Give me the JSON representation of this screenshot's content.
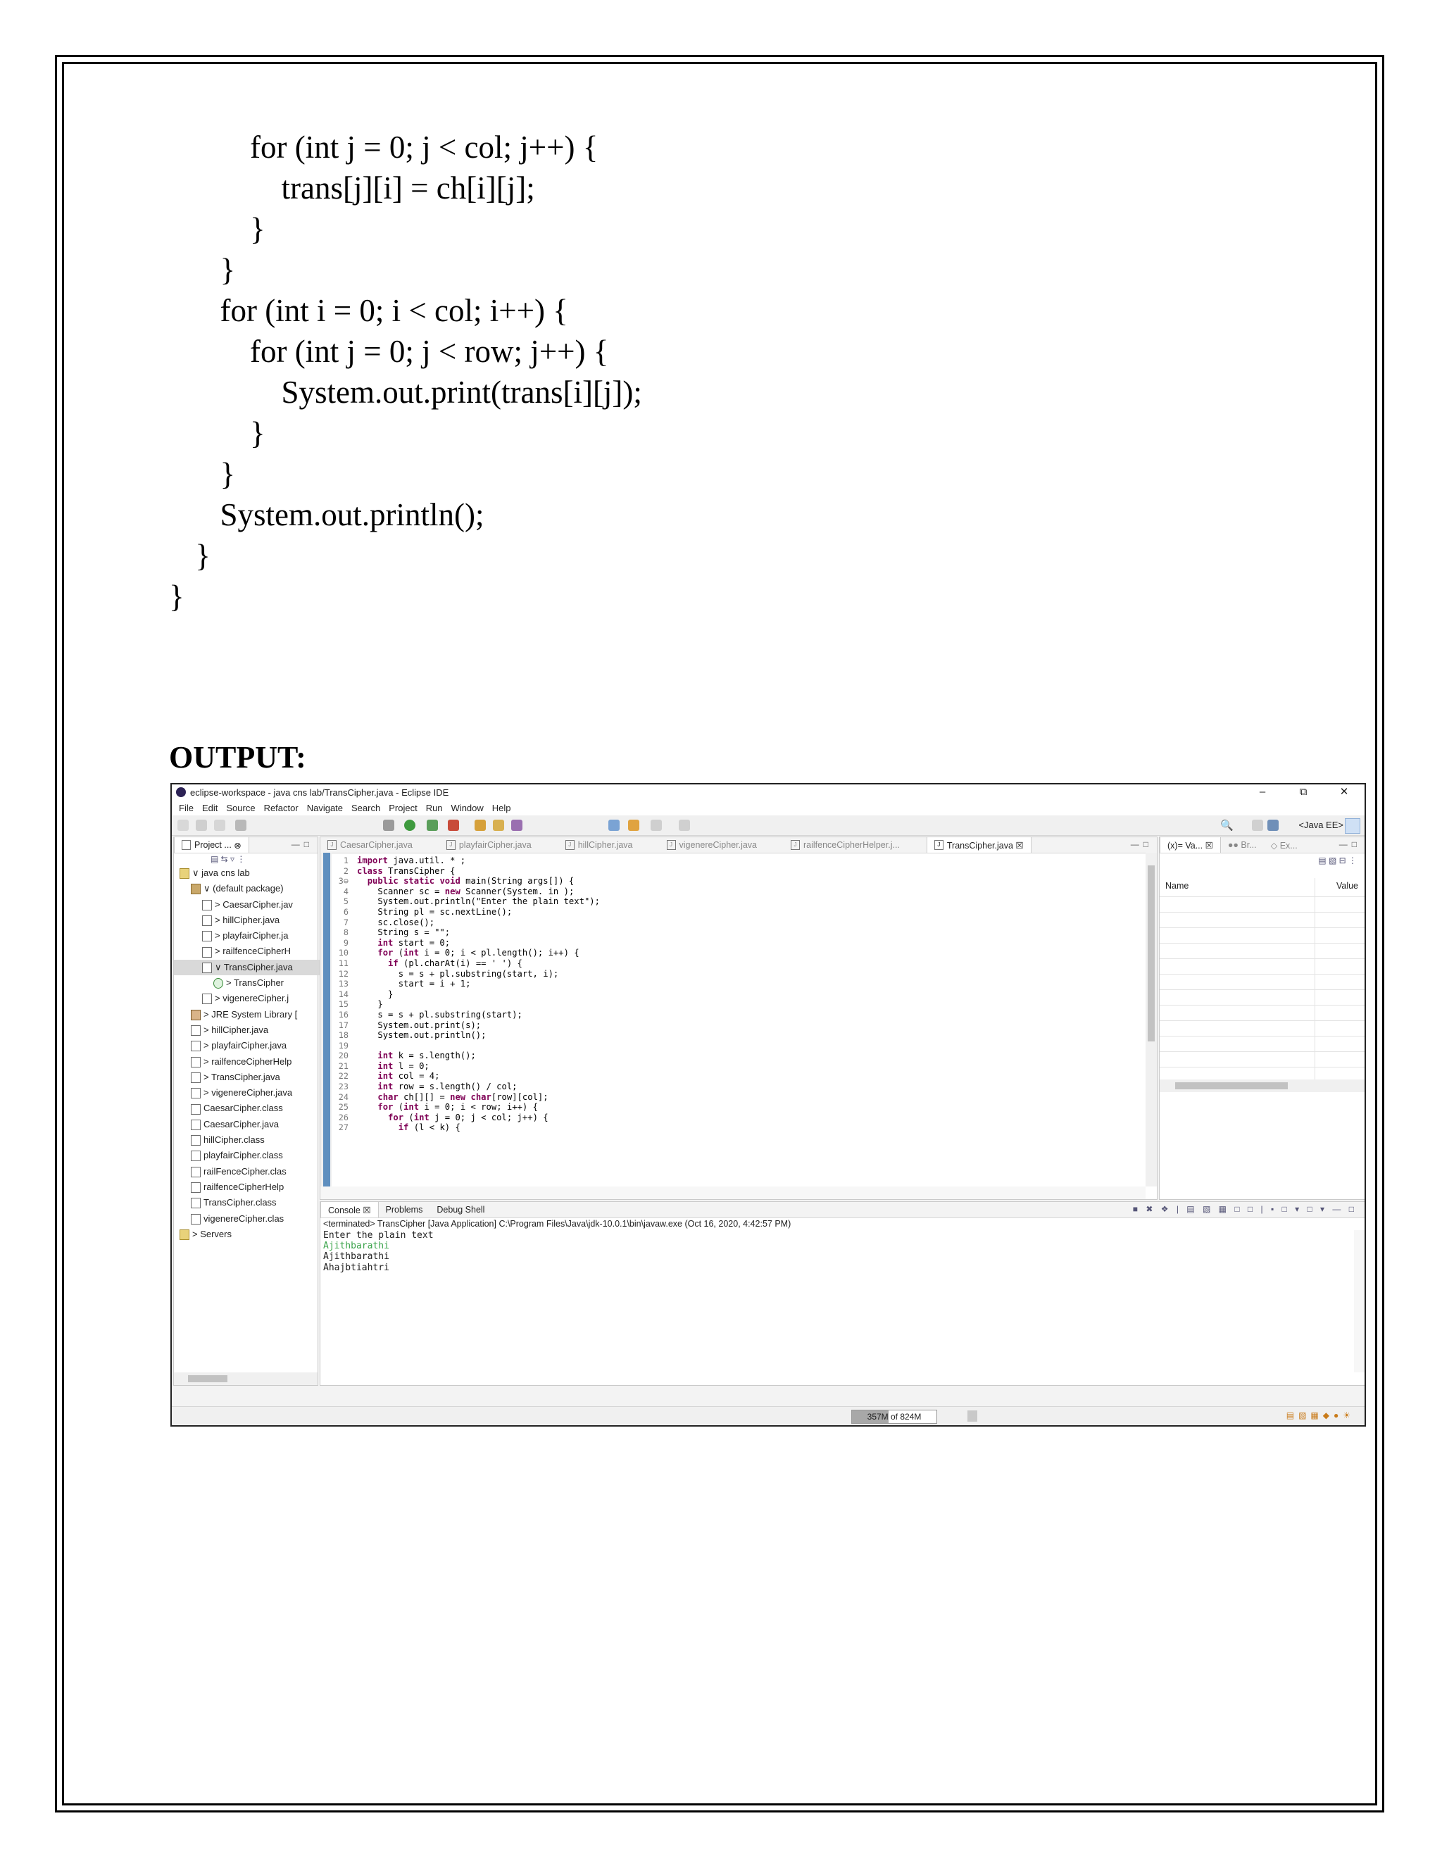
{
  "code_lines": [
    "    for (int j = 0; j < col; j++) {",
    "      trans[j][i] = ch[i][j];",
    "    }",
    "  }",
    "  for (int i = 0; i < col; i++) {",
    "    for (int j = 0; j < row; j++) {",
    "      System.out.print(trans[i][j]);",
    "    }",
    "  }",
    "  System.out.println();",
    " }",
    "}"
  ],
  "output_heading": "OUTPUT:",
  "screenshot": {
    "window_title": "eclipse-workspace - java cns lab/TransCipher.java - Eclipse IDE",
    "window_controls": [
      "–",
      "⧉",
      "✕"
    ],
    "menu": [
      "File",
      "Edit",
      "Source",
      "Refactor",
      "Navigate",
      "Search",
      "Project",
      "Run",
      "Window",
      "Help"
    ],
    "perspective": "<Java EE>",
    "project_explorer": {
      "tab_label": "Project ...",
      "tree": [
        {
          "indent": 0,
          "icon": "folder",
          "label": "∨ java cns lab"
        },
        {
          "indent": 1,
          "icon": "pkg",
          "label": "∨ (default package)"
        },
        {
          "indent": 2,
          "icon": "file",
          "label": "> CaesarCipher.jav"
        },
        {
          "indent": 2,
          "icon": "file",
          "label": "> hillCipher.java"
        },
        {
          "indent": 2,
          "icon": "file",
          "label": "> playfairCipher.ja"
        },
        {
          "indent": 2,
          "icon": "file",
          "label": "> railfenceCipherH"
        },
        {
          "indent": 2,
          "icon": "file",
          "label": "∨ TransCipher.java",
          "selected": true
        },
        {
          "indent": 3,
          "icon": "cls",
          "label": "> TransCipher"
        },
        {
          "indent": 2,
          "icon": "file",
          "label": "> vigenereCipher.j"
        },
        {
          "indent": 1,
          "icon": "lib",
          "label": "> JRE System Library ["
        },
        {
          "indent": 1,
          "icon": "file",
          "label": "> hillCipher.java"
        },
        {
          "indent": 1,
          "icon": "file",
          "label": "> playfairCipher.java"
        },
        {
          "indent": 1,
          "icon": "file",
          "label": "> railfenceCipherHelp"
        },
        {
          "indent": 1,
          "icon": "file",
          "label": "> TransCipher.java"
        },
        {
          "indent": 1,
          "icon": "file",
          "label": "> vigenereCipher.java"
        },
        {
          "indent": 1,
          "icon": "file",
          "label": "CaesarCipher.class"
        },
        {
          "indent": 1,
          "icon": "file",
          "label": "CaesarCipher.java"
        },
        {
          "indent": 1,
          "icon": "file",
          "label": "hillCipher.class"
        },
        {
          "indent": 1,
          "icon": "file",
          "label": "playfairCipher.class"
        },
        {
          "indent": 1,
          "icon": "file",
          "label": "railFenceCipher.clas"
        },
        {
          "indent": 1,
          "icon": "file",
          "label": "railfenceCipherHelp"
        },
        {
          "indent": 1,
          "icon": "file",
          "label": "TransCipher.class"
        },
        {
          "indent": 1,
          "icon": "file",
          "label": "vigenereCipher.clas"
        },
        {
          "indent": 0,
          "icon": "folder",
          "label": "> Servers"
        }
      ]
    },
    "editor_tabs": [
      {
        "label": "CaesarCipher.java",
        "active": false
      },
      {
        "label": "playfairCipher.java",
        "active": false
      },
      {
        "label": "hillCipher.java",
        "active": false
      },
      {
        "label": "vigenereCipher.java",
        "active": false
      },
      {
        "label": "railfenceCipherHelper.j...",
        "active": false
      },
      {
        "label": "TransCipher.java ☒",
        "active": true
      }
    ],
    "editor_lines": [
      "import java.util. * ;",
      "class TransCipher {",
      "  public static void main(String args[]) {",
      "    Scanner sc = new Scanner(System. in );",
      "    System.out.println(\"Enter the plain text\");",
      "    String pl = sc.nextLine();",
      "    sc.close();",
      "    String s = \"\";",
      "    int start = 0;",
      "    for (int i = 0; i < pl.length(); i++) {",
      "      if (pl.charAt(i) == ' ') {",
      "        s = s + pl.substring(start, i);",
      "        start = i + 1;",
      "      }",
      "    }",
      "    s = s + pl.substring(start);",
      "    System.out.print(s);",
      "    System.out.println();",
      "",
      "    int k = s.length();",
      "    int l = 0;",
      "    int col = 4;",
      "    int row = s.length() / col;",
      "    char ch[][] = new char[row][col];",
      "    for (int i = 0; i < row; i++) {",
      "      for (int j = 0; j < col; j++) {",
      "        if (l < k) {"
    ],
    "line_numbers": [
      "1",
      "2",
      "3⊖",
      "4",
      "5",
      "6",
      "7",
      "8",
      "9",
      "10",
      "11",
      "12",
      "13",
      "14",
      "15",
      "16",
      "17",
      "18",
      "19",
      "20",
      "21",
      "22",
      "23",
      "24",
      "25",
      "26",
      "27"
    ],
    "variables_tabs": [
      "(x)= Va... ☒",
      "●● Br...",
      "◇ Ex..."
    ],
    "variables_columns": [
      "Name",
      "Value"
    ],
    "console_tabs": [
      "Console ☒",
      "Problems",
      "Debug Shell"
    ],
    "console_terminated": "<terminated> TransCipher [Java Application] C:\\Program Files\\Java\\jdk-10.0.1\\bin\\javaw.exe (Oct 16, 2020, 4:42:57 PM)",
    "console_lines": [
      {
        "text": "Enter the plain text",
        "green": false
      },
      {
        "text": "Ajithbarathi",
        "green": true
      },
      {
        "text": "Ajithbarathi",
        "green": false
      },
      {
        "text": "Ahajbtiahtri",
        "green": false
      }
    ],
    "heap_status": "357M of 824M",
    "heap_fraction": 0.43,
    "colors": {
      "keyword": "#7f0055",
      "console_input": "#3aa34a",
      "selection": "#d9d9d9"
    }
  }
}
